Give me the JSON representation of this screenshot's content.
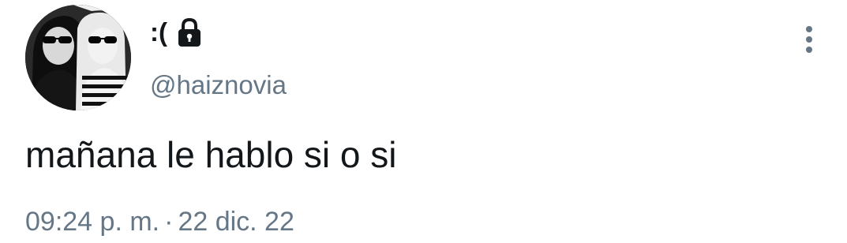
{
  "tweet": {
    "author": {
      "display_name": ":(",
      "handle": "@haiznovia",
      "protected": true,
      "avatar_icon": "avatar-photo-icon"
    },
    "text": "mañana le hablo si o si",
    "time": "09:24 p. m.",
    "separator": "·",
    "date": "22 dic. 22",
    "more_icon": "more-vertical-icon"
  },
  "colors": {
    "text_primary": "#14171a",
    "text_secondary": "#657786",
    "background": "#ffffff"
  }
}
